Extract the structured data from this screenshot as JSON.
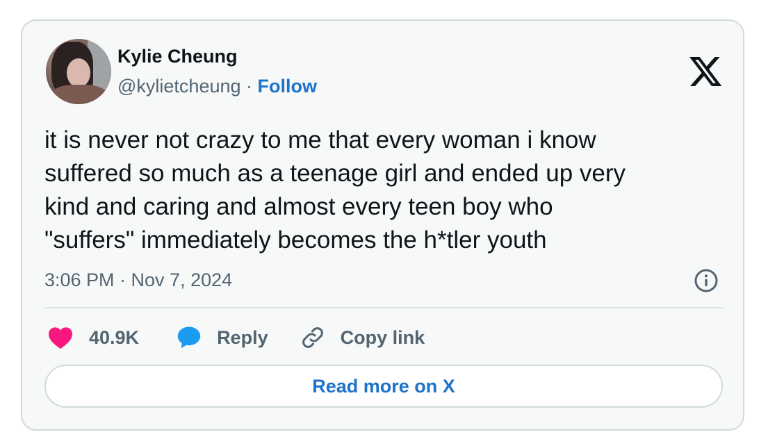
{
  "author": {
    "name": "Kylie Cheung",
    "handle": "@kylietcheung",
    "separator": "·",
    "follow_label": "Follow"
  },
  "tweet": {
    "lines": [
      "it is never not crazy to me that every woman i know",
      "suffered so much as a teenage girl and ended up very",
      "kind and caring and almost every teen boy who",
      "\"suffers\" immediately becomes the h*tler youth"
    ],
    "timestamp": "3:06 PM · Nov 7, 2024"
  },
  "actions": {
    "like_count": "40.9K",
    "reply_label": "Reply",
    "copy_link_label": "Copy link"
  },
  "read_more_label": "Read more on X",
  "icons": {
    "logo": "x-logo-icon",
    "info": "info-icon",
    "like": "heart-icon",
    "reply": "speech-bubble-icon",
    "copy": "link-icon"
  },
  "colors": {
    "accent": "#1d72c9",
    "heart": "#f91880",
    "reply_bubble": "#1d9bf0",
    "muted_text": "#536471",
    "card_background": "#f7f9f9",
    "border": "#cfd9de"
  }
}
